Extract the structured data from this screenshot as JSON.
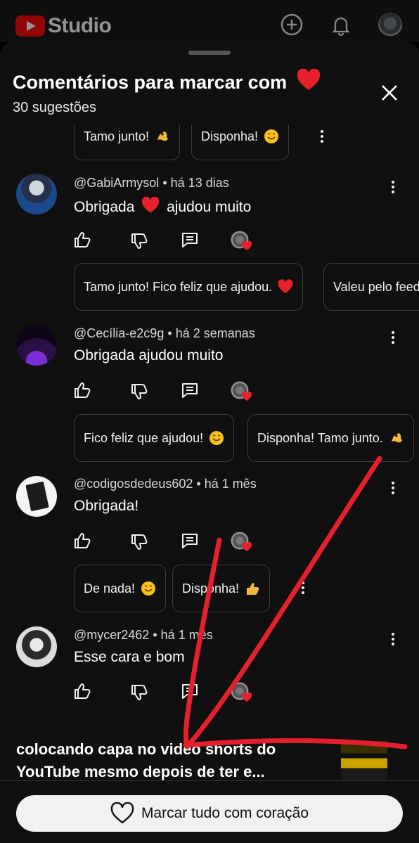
{
  "app": {
    "name": "Studio"
  },
  "sheet": {
    "title": "Comentários para marcar com",
    "subtitle": "30 sugestões"
  },
  "top_chips": [
    {
      "label": "Tamo junto!",
      "emoji": "flexed-biceps"
    },
    {
      "label": "Disponha!",
      "emoji": "smiling-face"
    }
  ],
  "comments": [
    {
      "author": "@GabiArmysol",
      "time": "há 13 dias",
      "text_before": "Obrigada",
      "text_after": "ajudou muito",
      "has_heart": true,
      "chips": [
        {
          "label": "Tamo junto! Fico feliz que ajudou.",
          "emoji": "red-heart"
        },
        {
          "label": "Valeu pelo feed",
          "emoji": ""
        }
      ]
    },
    {
      "author": "@Cecília-e2c9g",
      "time": "há 2 semanas",
      "text_before": "Obrigada ajudou muito",
      "text_after": "",
      "has_heart": false,
      "chips": [
        {
          "label": "Fico feliz que ajudou!",
          "emoji": "smiling-face"
        },
        {
          "label": "Disponha! Tamo junto.",
          "emoji": "flexed-biceps"
        }
      ]
    },
    {
      "author": "@codigosdedeus602",
      "time": "há 1 mês",
      "text_before": "Obrigada!",
      "text_after": "",
      "has_heart": false,
      "chips": [
        {
          "label": "De nada!",
          "emoji": "smiling-face"
        },
        {
          "label": "Disponha!",
          "emoji": "thumbs-up"
        }
      ]
    },
    {
      "author": "@mycer2462",
      "time": "há 1 mês",
      "text_before": "Esse cara e bom",
      "text_after": "",
      "has_heart": false,
      "chips": []
    }
  ],
  "separator": "•",
  "video": {
    "title": "colocando capa no video shorts do YouTube mesmo depois de ter e..."
  },
  "bottom": {
    "mark_all_label": "Marcar tudo com coração"
  },
  "colors": {
    "background": "#101010",
    "heart": "#e8202a",
    "annotation": "#e51f2b",
    "youtube_red": "#ff0000"
  }
}
